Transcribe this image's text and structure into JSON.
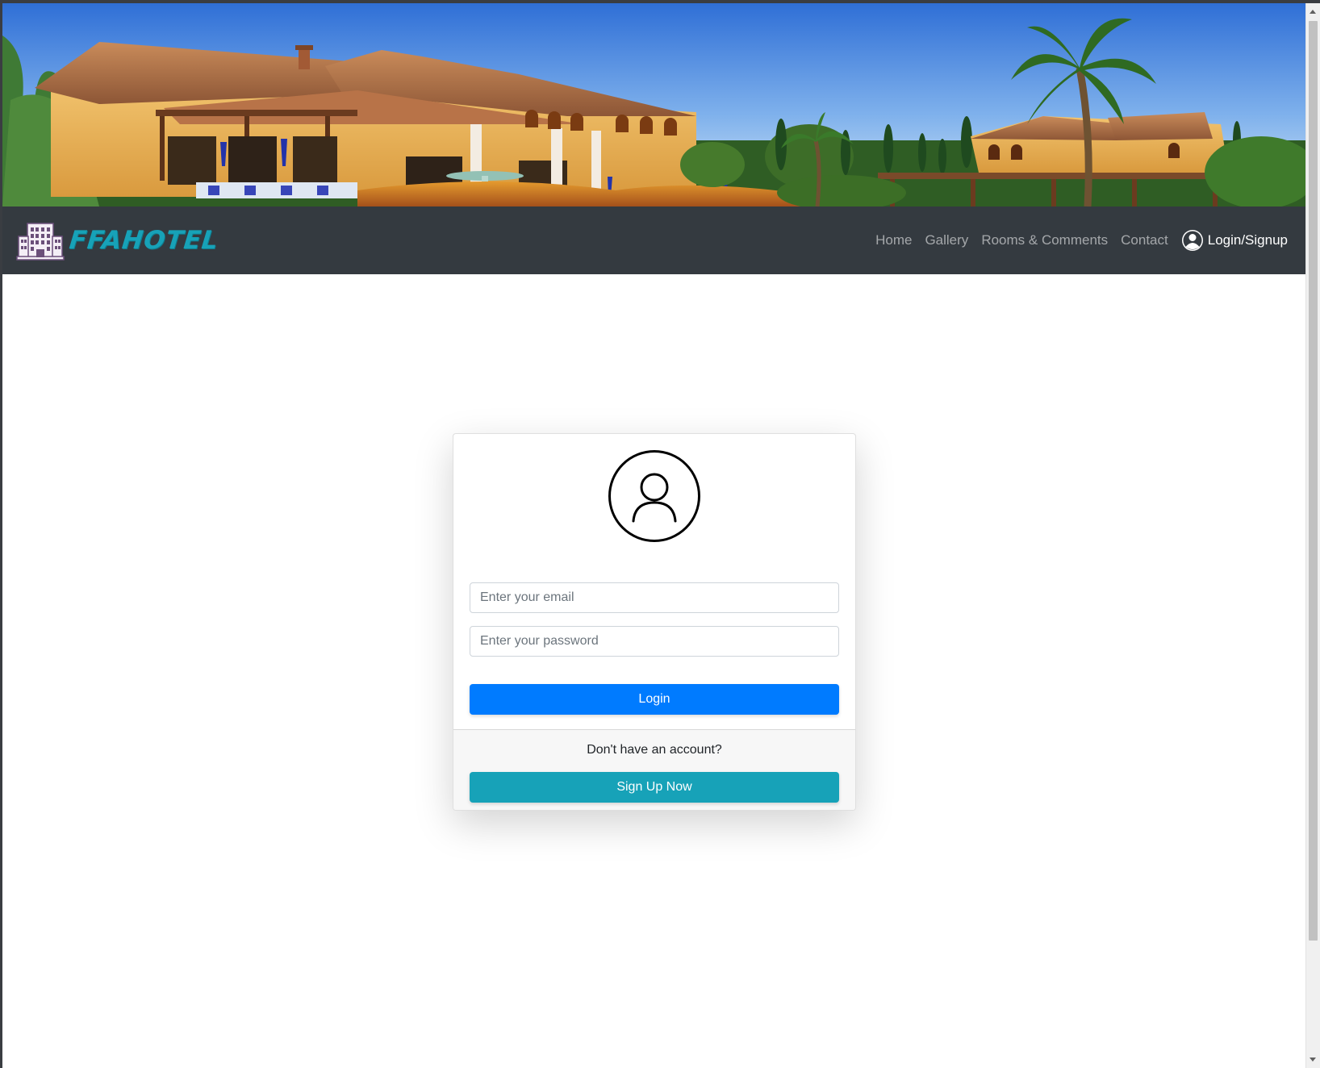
{
  "brand": {
    "name": "FFAHOTEL",
    "logo_icon": "hotel-building-icon",
    "accent_color": "#17a2b8"
  },
  "nav": {
    "items": [
      {
        "label": "Home"
      },
      {
        "label": "Gallery"
      },
      {
        "label": "Rooms & Comments"
      },
      {
        "label": "Contact"
      }
    ],
    "login_label": "Login/Signup",
    "login_icon": "user-circle-icon",
    "background_color": "#343a40"
  },
  "banner": {
    "icon": "hotel-banner-image"
  },
  "login_form": {
    "avatar_icon": "user-avatar-icon",
    "email_placeholder": "Enter your email",
    "password_placeholder": "Enter your password",
    "login_button": "Login",
    "login_color": "#007bff",
    "footer_text": "Don't have an account?",
    "signup_button": "Sign Up Now",
    "signup_color": "#17a2b8"
  }
}
